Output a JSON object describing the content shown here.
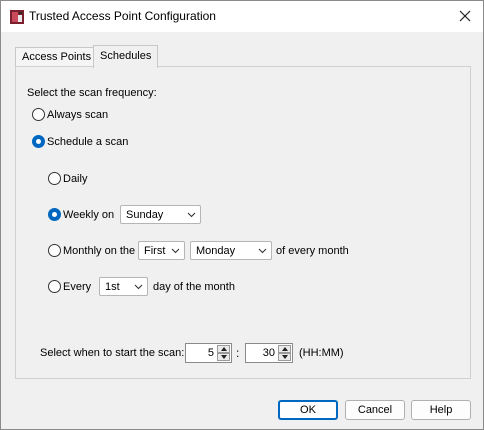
{
  "window": {
    "title": "Trusted Access Point Configuration",
    "icons": {
      "app": "network-config-icon",
      "close": "close-icon"
    }
  },
  "tabs": [
    {
      "label": "Access Points",
      "active": false
    },
    {
      "label": "Schedules",
      "active": true
    }
  ],
  "schedules": {
    "frequency_prompt": "Select the scan frequency:",
    "always_scan": {
      "label": "Always scan",
      "checked": false
    },
    "schedule_scan": {
      "label": "Schedule a scan",
      "checked": true
    },
    "daily": {
      "label": "Daily",
      "checked": false
    },
    "weekly": {
      "label": "Weekly on",
      "checked": true,
      "day": "Sunday"
    },
    "monthly": {
      "label": "Monthly on the",
      "checked": false,
      "ordinal": "First",
      "weekday": "Monday",
      "suffix": "of every month"
    },
    "every": {
      "label": "Every",
      "checked": false,
      "day": "1st",
      "suffix": "day of the month"
    },
    "start_time": {
      "label": "Select when to start the scan:",
      "hour": "5",
      "separator": ":",
      "minute": "30",
      "format": "(HH:MM)"
    }
  },
  "buttons": {
    "ok": "OK",
    "cancel": "Cancel",
    "help": "Help"
  },
  "colors": {
    "accent": "#0067c0",
    "background": "#f0f0f0"
  }
}
